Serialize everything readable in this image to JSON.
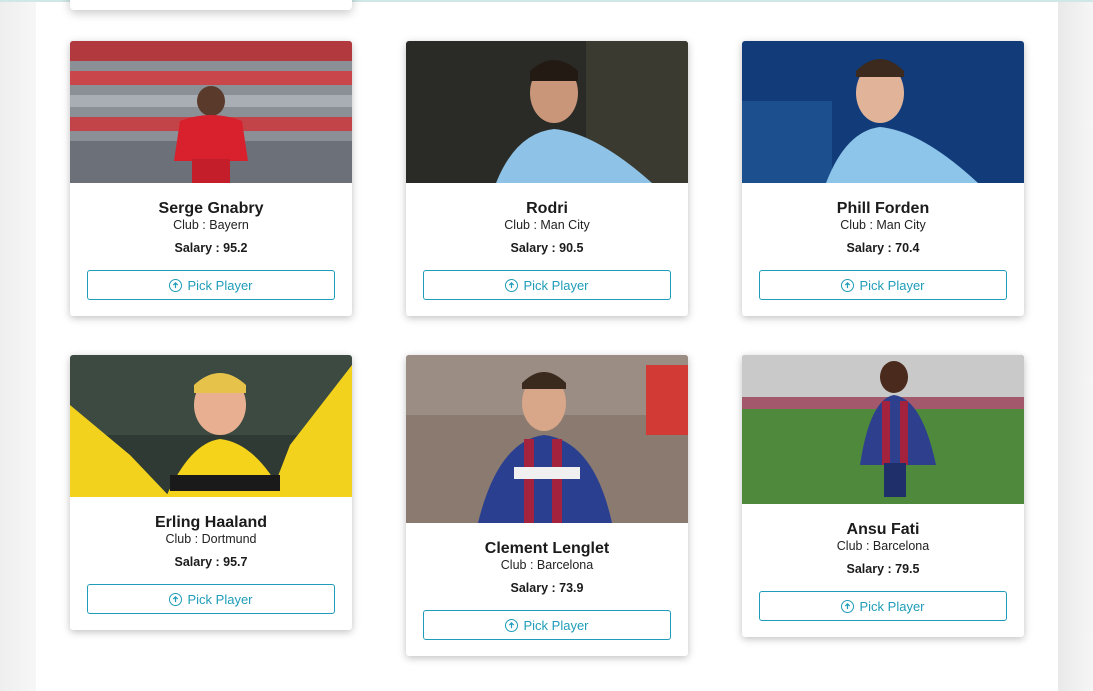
{
  "button_label": "Pick Player",
  "colors": {
    "accent": "#1f9cb8",
    "card_bg": "#ffffff",
    "page_bg": "#f1f2f3"
  },
  "players": [
    {
      "name": "Serge Gnabry",
      "club": "Club : Bayern",
      "salary": "Salary : 95.2",
      "jersey": "bayern"
    },
    {
      "name": "Rodri",
      "club": "Club : Man City",
      "salary": "Salary : 90.5",
      "jersey": "mancity"
    },
    {
      "name": "Phill Forden",
      "club": "Club : Man City",
      "salary": "Salary : 70.4",
      "jersey": "mancity"
    },
    {
      "name": "Erling Haaland",
      "club": "Club : Dortmund",
      "salary": "Salary : 95.7",
      "jersey": "dortmund"
    },
    {
      "name": "Clement Lenglet",
      "club": "Club : Barcelona",
      "salary": "Salary : 73.9",
      "jersey": "barcelona"
    },
    {
      "name": "Ansu Fati",
      "club": "Club : Barcelona",
      "salary": "Salary : 79.5",
      "jersey": "barcelona"
    }
  ]
}
